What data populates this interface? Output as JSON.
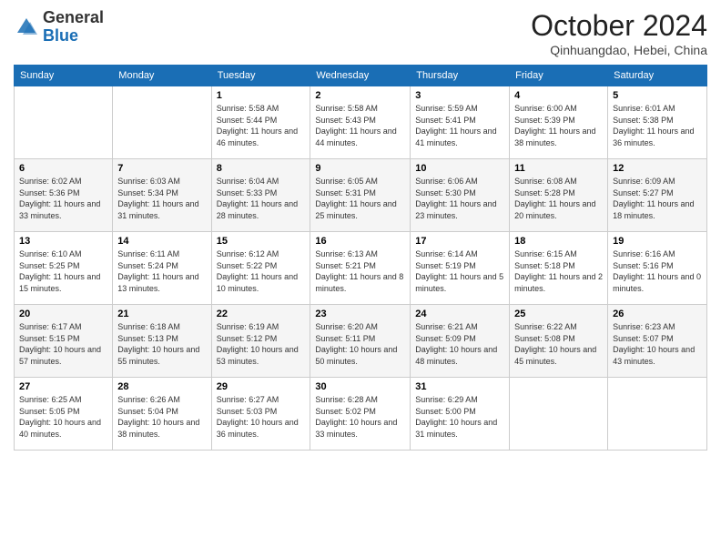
{
  "header": {
    "logo_general": "General",
    "logo_blue": "Blue",
    "month_title": "October 2024",
    "location": "Qinhuangdao, Hebei, China"
  },
  "days_of_week": [
    "Sunday",
    "Monday",
    "Tuesday",
    "Wednesday",
    "Thursday",
    "Friday",
    "Saturday"
  ],
  "weeks": [
    [
      {
        "day": "",
        "sunrise": "",
        "sunset": "",
        "daylight": ""
      },
      {
        "day": "",
        "sunrise": "",
        "sunset": "",
        "daylight": ""
      },
      {
        "day": "1",
        "sunrise": "Sunrise: 5:58 AM",
        "sunset": "Sunset: 5:44 PM",
        "daylight": "Daylight: 11 hours and 46 minutes."
      },
      {
        "day": "2",
        "sunrise": "Sunrise: 5:58 AM",
        "sunset": "Sunset: 5:43 PM",
        "daylight": "Daylight: 11 hours and 44 minutes."
      },
      {
        "day": "3",
        "sunrise": "Sunrise: 5:59 AM",
        "sunset": "Sunset: 5:41 PM",
        "daylight": "Daylight: 11 hours and 41 minutes."
      },
      {
        "day": "4",
        "sunrise": "Sunrise: 6:00 AM",
        "sunset": "Sunset: 5:39 PM",
        "daylight": "Daylight: 11 hours and 38 minutes."
      },
      {
        "day": "5",
        "sunrise": "Sunrise: 6:01 AM",
        "sunset": "Sunset: 5:38 PM",
        "daylight": "Daylight: 11 hours and 36 minutes."
      }
    ],
    [
      {
        "day": "6",
        "sunrise": "Sunrise: 6:02 AM",
        "sunset": "Sunset: 5:36 PM",
        "daylight": "Daylight: 11 hours and 33 minutes."
      },
      {
        "day": "7",
        "sunrise": "Sunrise: 6:03 AM",
        "sunset": "Sunset: 5:34 PM",
        "daylight": "Daylight: 11 hours and 31 minutes."
      },
      {
        "day": "8",
        "sunrise": "Sunrise: 6:04 AM",
        "sunset": "Sunset: 5:33 PM",
        "daylight": "Daylight: 11 hours and 28 minutes."
      },
      {
        "day": "9",
        "sunrise": "Sunrise: 6:05 AM",
        "sunset": "Sunset: 5:31 PM",
        "daylight": "Daylight: 11 hours and 25 minutes."
      },
      {
        "day": "10",
        "sunrise": "Sunrise: 6:06 AM",
        "sunset": "Sunset: 5:30 PM",
        "daylight": "Daylight: 11 hours and 23 minutes."
      },
      {
        "day": "11",
        "sunrise": "Sunrise: 6:08 AM",
        "sunset": "Sunset: 5:28 PM",
        "daylight": "Daylight: 11 hours and 20 minutes."
      },
      {
        "day": "12",
        "sunrise": "Sunrise: 6:09 AM",
        "sunset": "Sunset: 5:27 PM",
        "daylight": "Daylight: 11 hours and 18 minutes."
      }
    ],
    [
      {
        "day": "13",
        "sunrise": "Sunrise: 6:10 AM",
        "sunset": "Sunset: 5:25 PM",
        "daylight": "Daylight: 11 hours and 15 minutes."
      },
      {
        "day": "14",
        "sunrise": "Sunrise: 6:11 AM",
        "sunset": "Sunset: 5:24 PM",
        "daylight": "Daylight: 11 hours and 13 minutes."
      },
      {
        "day": "15",
        "sunrise": "Sunrise: 6:12 AM",
        "sunset": "Sunset: 5:22 PM",
        "daylight": "Daylight: 11 hours and 10 minutes."
      },
      {
        "day": "16",
        "sunrise": "Sunrise: 6:13 AM",
        "sunset": "Sunset: 5:21 PM",
        "daylight": "Daylight: 11 hours and 8 minutes."
      },
      {
        "day": "17",
        "sunrise": "Sunrise: 6:14 AM",
        "sunset": "Sunset: 5:19 PM",
        "daylight": "Daylight: 11 hours and 5 minutes."
      },
      {
        "day": "18",
        "sunrise": "Sunrise: 6:15 AM",
        "sunset": "Sunset: 5:18 PM",
        "daylight": "Daylight: 11 hours and 2 minutes."
      },
      {
        "day": "19",
        "sunrise": "Sunrise: 6:16 AM",
        "sunset": "Sunset: 5:16 PM",
        "daylight": "Daylight: 11 hours and 0 minutes."
      }
    ],
    [
      {
        "day": "20",
        "sunrise": "Sunrise: 6:17 AM",
        "sunset": "Sunset: 5:15 PM",
        "daylight": "Daylight: 10 hours and 57 minutes."
      },
      {
        "day": "21",
        "sunrise": "Sunrise: 6:18 AM",
        "sunset": "Sunset: 5:13 PM",
        "daylight": "Daylight: 10 hours and 55 minutes."
      },
      {
        "day": "22",
        "sunrise": "Sunrise: 6:19 AM",
        "sunset": "Sunset: 5:12 PM",
        "daylight": "Daylight: 10 hours and 53 minutes."
      },
      {
        "day": "23",
        "sunrise": "Sunrise: 6:20 AM",
        "sunset": "Sunset: 5:11 PM",
        "daylight": "Daylight: 10 hours and 50 minutes."
      },
      {
        "day": "24",
        "sunrise": "Sunrise: 6:21 AM",
        "sunset": "Sunset: 5:09 PM",
        "daylight": "Daylight: 10 hours and 48 minutes."
      },
      {
        "day": "25",
        "sunrise": "Sunrise: 6:22 AM",
        "sunset": "Sunset: 5:08 PM",
        "daylight": "Daylight: 10 hours and 45 minutes."
      },
      {
        "day": "26",
        "sunrise": "Sunrise: 6:23 AM",
        "sunset": "Sunset: 5:07 PM",
        "daylight": "Daylight: 10 hours and 43 minutes."
      }
    ],
    [
      {
        "day": "27",
        "sunrise": "Sunrise: 6:25 AM",
        "sunset": "Sunset: 5:05 PM",
        "daylight": "Daylight: 10 hours and 40 minutes."
      },
      {
        "day": "28",
        "sunrise": "Sunrise: 6:26 AM",
        "sunset": "Sunset: 5:04 PM",
        "daylight": "Daylight: 10 hours and 38 minutes."
      },
      {
        "day": "29",
        "sunrise": "Sunrise: 6:27 AM",
        "sunset": "Sunset: 5:03 PM",
        "daylight": "Daylight: 10 hours and 36 minutes."
      },
      {
        "day": "30",
        "sunrise": "Sunrise: 6:28 AM",
        "sunset": "Sunset: 5:02 PM",
        "daylight": "Daylight: 10 hours and 33 minutes."
      },
      {
        "day": "31",
        "sunrise": "Sunrise: 6:29 AM",
        "sunset": "Sunset: 5:00 PM",
        "daylight": "Daylight: 10 hours and 31 minutes."
      },
      {
        "day": "",
        "sunrise": "",
        "sunset": "",
        "daylight": ""
      },
      {
        "day": "",
        "sunrise": "",
        "sunset": "",
        "daylight": ""
      }
    ]
  ]
}
